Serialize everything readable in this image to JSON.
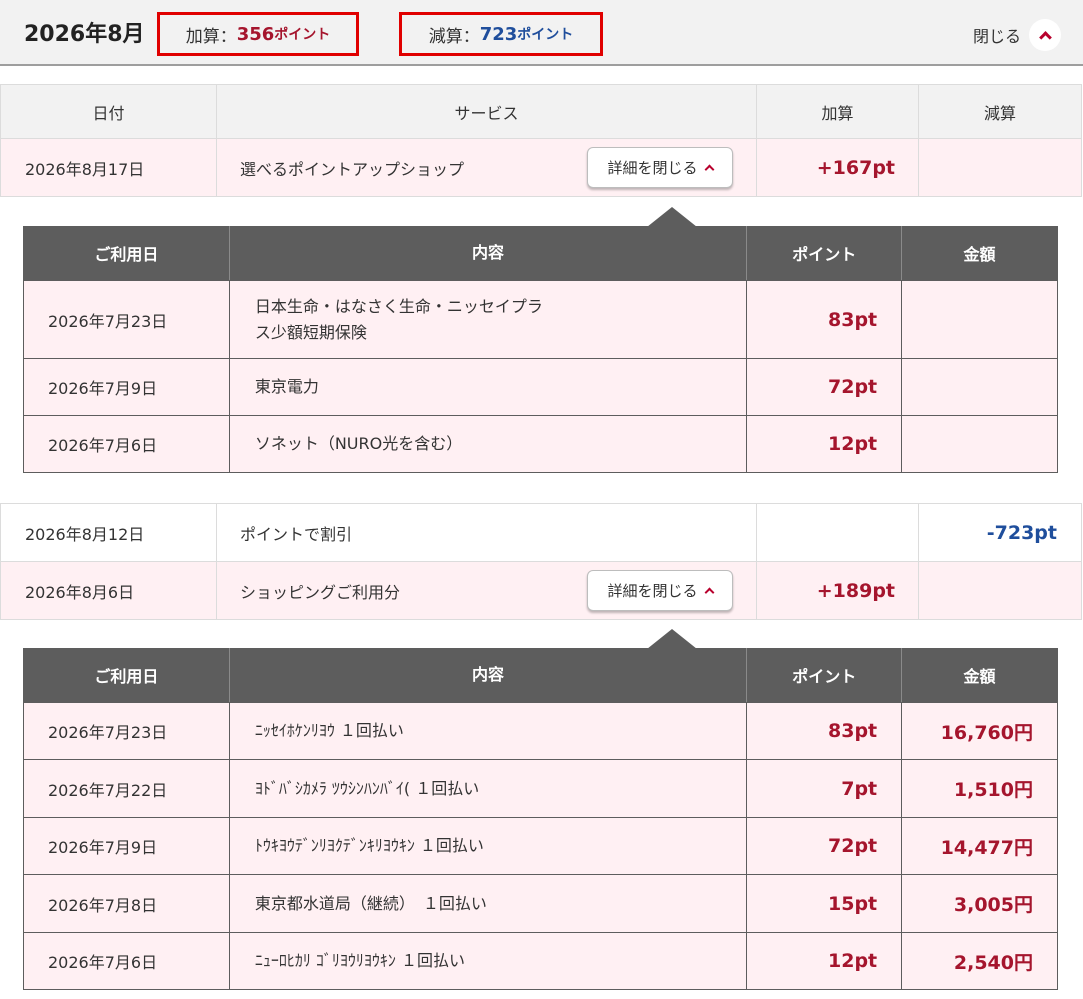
{
  "header": {
    "month": "2026年8月",
    "add_label": "加算：",
    "add_value": "356",
    "sub_label": "減算：",
    "sub_value": "723",
    "points_unit": "ポイント",
    "close_label": "閉じる"
  },
  "columns": {
    "date": "日付",
    "service": "サービス",
    "add": "加算",
    "sub": "減算"
  },
  "detail_columns": {
    "date": "ご利用日",
    "content": "内容",
    "points": "ポイント",
    "amount": "金額"
  },
  "detail_button_label": "詳細を閉じる",
  "entries": [
    {
      "date": "2026年8月17日",
      "service": "選べるポイントアップショップ",
      "add": "+167pt",
      "sub": "",
      "details": [
        {
          "date": "2026年7月23日",
          "content_line1": "日本生命・はなさく生命・ニッセイプラ",
          "content_line2": "ス少額短期保険",
          "points": "83pt",
          "amount": ""
        },
        {
          "date": "2026年7月9日",
          "content": "東京電力",
          "points": "72pt",
          "amount": ""
        },
        {
          "date": "2026年7月6日",
          "content": "ソネット（NURO光を含む）",
          "points": "12pt",
          "amount": ""
        }
      ]
    },
    {
      "date": "2026年8月12日",
      "service": "ポイントで割引",
      "add": "",
      "sub": "-723pt"
    },
    {
      "date": "2026年8月6日",
      "service": "ショッピングご利用分",
      "add": "+189pt",
      "sub": "",
      "details": [
        {
          "date": "2026年7月23日",
          "content": "ﾆｯｾｲﾎｹﾝﾘﾖｳ １回払い",
          "points": "83pt",
          "amount": "16,760円"
        },
        {
          "date": "2026年7月22日",
          "content": "ﾖﾄﾞﾊﾞｼｶﾒﾗ ﾂｳｼﾝﾊﾝﾊﾞｲ( １回払い",
          "points": "7pt",
          "amount": "1,510円"
        },
        {
          "date": "2026年7月9日",
          "content": "ﾄｳｷﾖｳﾃﾞﾝﾘﾖｸﾃﾞﾝｷﾘﾖｳｷﾝ １回払い",
          "points": "72pt",
          "amount": "14,477円"
        },
        {
          "date": "2026年7月8日",
          "content": "東京都水道局（継続）　１回払い",
          "points": "15pt",
          "amount": "3,005円"
        },
        {
          "date": "2026年7月6日",
          "content": "ﾆｭｰﾛﾋｶﾘ ｺﾞﾘﾖｳﾘﾖｳｷﾝ １回払い",
          "points": "12pt",
          "amount": "2,540円"
        }
      ]
    }
  ]
}
